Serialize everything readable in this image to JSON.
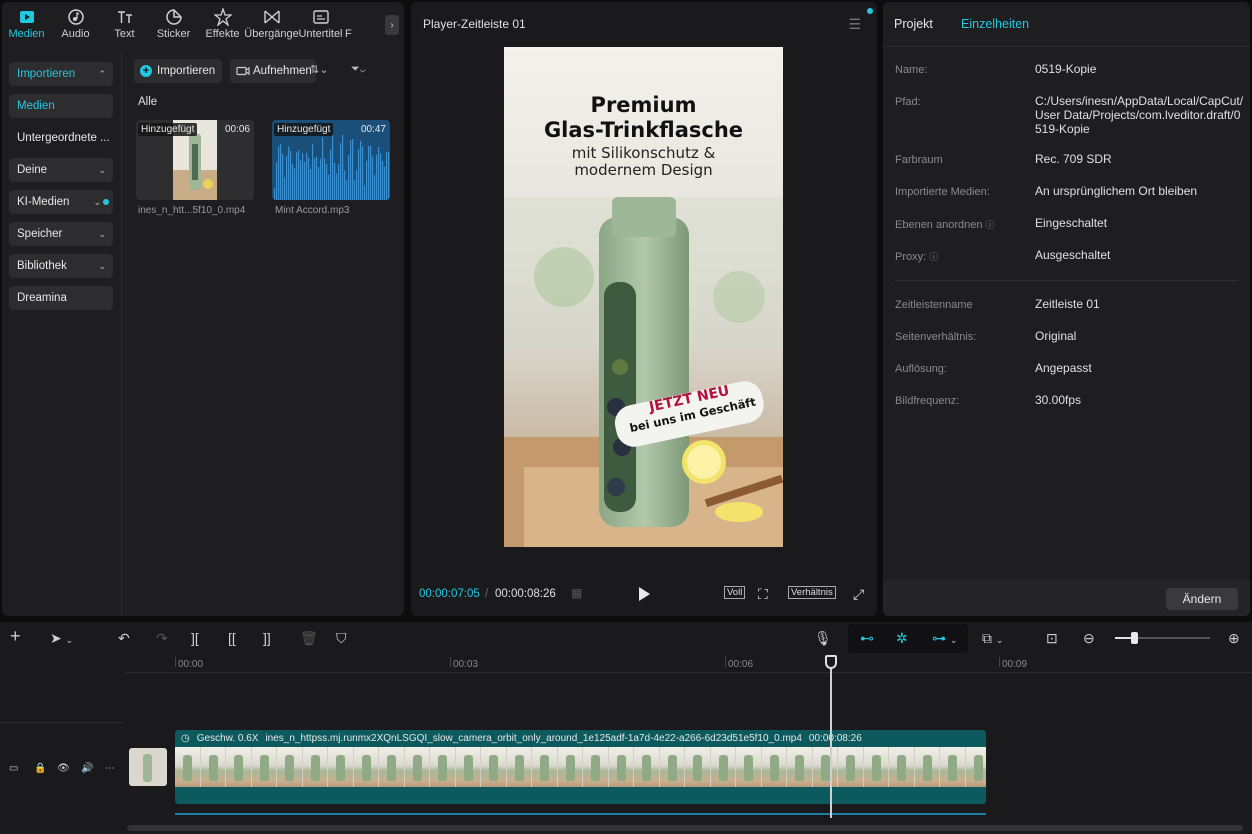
{
  "media_panel": {
    "tabs": [
      {
        "label": "Medien",
        "icon": "media-icon"
      },
      {
        "label": "Audio",
        "icon": "audio-icon"
      },
      {
        "label": "Text",
        "icon": "text-icon"
      },
      {
        "label": "Sticker",
        "icon": "sticker-icon"
      },
      {
        "label": "Effekte",
        "icon": "effects-icon"
      },
      {
        "label": "Übergänge",
        "icon": "transitions-icon"
      },
      {
        "label": "Untertitel",
        "icon": "captions-icon"
      },
      {
        "label": "F",
        "icon": "filter-icon"
      }
    ],
    "sidebar": {
      "import": "Importieren",
      "media": "Medien",
      "sub": "Untergeordnete ...",
      "yours": "Deine",
      "ai_media": "KI-Medien",
      "storage": "Speicher",
      "library": "Bibliothek",
      "dreamina": "Dreamina"
    },
    "import_button": "Importieren",
    "record_button": "Aufnehmen",
    "all_label": "Alle",
    "items": [
      {
        "badge": "Hinzugefügt",
        "duration": "00:06",
        "name": "ines_n_htt...5f10_0.mp4"
      },
      {
        "badge": "Hinzugefügt",
        "duration": "00:47",
        "name": "Mint Accord.mp3"
      }
    ]
  },
  "player": {
    "title": "Player-Zeitleiste 01",
    "current_time": "00:00:07:05",
    "separator": "/",
    "total_time": "00:00:08:26",
    "btn_full": "Voll",
    "btn_ratio": "Verhältnis",
    "video": {
      "headline1": "Premium",
      "headline2": "Glas-Trinkflasche",
      "sub1": "mit Silikonschutz &",
      "sub2": "modernem Design",
      "badge1": "JETZT NEU",
      "badge2": "bei uns im Geschäft"
    }
  },
  "details": {
    "tab_project": "Projekt",
    "tab_details": "Einzelheiten",
    "rows": [
      {
        "label": "Name:",
        "value": "0519-Kopie"
      },
      {
        "label": "Pfad:",
        "value": "C:/Users/inesn/AppData/Local/CapCut/User Data/Projects/com.lveditor.draft/0519-Kopie"
      },
      {
        "label": "Farbraum",
        "value": "Rec. 709 SDR"
      },
      {
        "label": "Importierte Medien:",
        "value": "An ursprünglichem Ort bleiben"
      },
      {
        "label": "Ebenen anordnen",
        "value": "Eingeschaltet"
      },
      {
        "label": "Proxy:",
        "value": "Ausgeschaltet"
      },
      {
        "label": "Zeitleistenname",
        "value": "Zeitleiste 01"
      },
      {
        "label": "Seitenverhältnis:",
        "value": "Original"
      },
      {
        "label": "Auflösung:",
        "value": "Angepasst"
      },
      {
        "label": "Bildfrequenz:",
        "value": "30.00fps"
      }
    ],
    "change_button": "Ändern"
  },
  "timeline": {
    "ruler": [
      "00:00",
      "00:03",
      "00:06",
      "00:09"
    ],
    "clip": {
      "speed": "Geschw. 0.6X",
      "filename": "ines_n_httpss.mj.runmx2XQnLSGQI_slow_camera_orbit_only_around_1e125adf-1a7d-4e22-a266-6d23d51e5f10_0.mp4",
      "duration": "00:00:08:26"
    }
  },
  "colors": {
    "accent": "#22c8e0",
    "clip": "#0c5a5e",
    "panel": "#1e1e20"
  }
}
